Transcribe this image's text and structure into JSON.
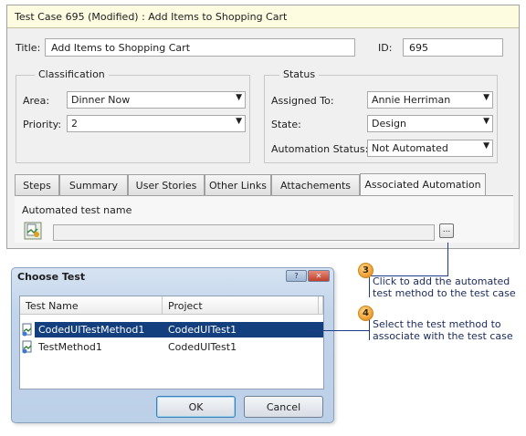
{
  "test_case": {
    "title_bar": "Test Case 695 (Modified) : Add Items to Shopping Cart",
    "title_label": "Title:",
    "title_value": "Add Items to Shopping Cart",
    "id_label": "ID:",
    "id_value": "695",
    "classification": {
      "heading": "Classification",
      "area_label": "Area:",
      "area_value": "Dinner Now",
      "priority_label": "Priority:",
      "priority_value": "2"
    },
    "status": {
      "heading": "Status",
      "assigned_label": "Assigned To:",
      "assigned_value": "Annie Herriman",
      "state_label": "State:",
      "state_value": "Design",
      "automation_label": "Automation Status:",
      "automation_value": "Not Automated"
    },
    "tabs": [
      "Steps",
      "Summary",
      "User Stories",
      "Other Links",
      "Attachements",
      "Associated Automation"
    ],
    "automated_test_label": "Automated test name",
    "automated_test_value": "",
    "browse_label": "..."
  },
  "dialog": {
    "title": "Choose Test",
    "columns": [
      "Test Name",
      "Project"
    ],
    "rows": [
      {
        "name": "CodedUITestMethod1",
        "project": "CodedUITest1",
        "selected": true
      },
      {
        "name": "TestMethod1",
        "project": "CodedUITest1",
        "selected": false
      }
    ],
    "ok_label": "OK",
    "cancel_label": "Cancel"
  },
  "callouts": [
    {
      "number": "3",
      "text": "Click to add the automated test method to the test case"
    },
    {
      "number": "4",
      "text": "Select the test method to associate with the test case"
    }
  ],
  "colors": {
    "title_bar_bg": "#fdfbe0",
    "selection": "#133f7e",
    "callout_line": "#1f3c8a",
    "callout_badge": "#f2a23a"
  }
}
